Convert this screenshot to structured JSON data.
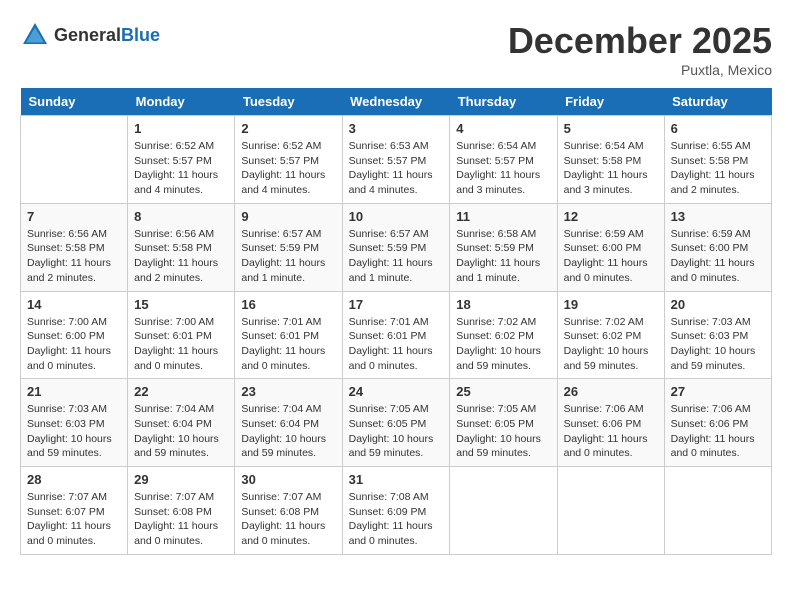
{
  "header": {
    "logo": {
      "general": "General",
      "blue": "Blue"
    },
    "title": "December 2025",
    "location": "Puxtla, Mexico"
  },
  "days_of_week": [
    "Sunday",
    "Monday",
    "Tuesday",
    "Wednesday",
    "Thursday",
    "Friday",
    "Saturday"
  ],
  "weeks": [
    [
      {
        "day": "",
        "info": ""
      },
      {
        "day": "1",
        "info": "Sunrise: 6:52 AM\nSunset: 5:57 PM\nDaylight: 11 hours and 4 minutes."
      },
      {
        "day": "2",
        "info": "Sunrise: 6:52 AM\nSunset: 5:57 PM\nDaylight: 11 hours and 4 minutes."
      },
      {
        "day": "3",
        "info": "Sunrise: 6:53 AM\nSunset: 5:57 PM\nDaylight: 11 hours and 4 minutes."
      },
      {
        "day": "4",
        "info": "Sunrise: 6:54 AM\nSunset: 5:57 PM\nDaylight: 11 hours and 3 minutes."
      },
      {
        "day": "5",
        "info": "Sunrise: 6:54 AM\nSunset: 5:58 PM\nDaylight: 11 hours and 3 minutes."
      },
      {
        "day": "6",
        "info": "Sunrise: 6:55 AM\nSunset: 5:58 PM\nDaylight: 11 hours and 2 minutes."
      }
    ],
    [
      {
        "day": "7",
        "info": "Sunrise: 6:56 AM\nSunset: 5:58 PM\nDaylight: 11 hours and 2 minutes."
      },
      {
        "day": "8",
        "info": "Sunrise: 6:56 AM\nSunset: 5:58 PM\nDaylight: 11 hours and 2 minutes."
      },
      {
        "day": "9",
        "info": "Sunrise: 6:57 AM\nSunset: 5:59 PM\nDaylight: 11 hours and 1 minute."
      },
      {
        "day": "10",
        "info": "Sunrise: 6:57 AM\nSunset: 5:59 PM\nDaylight: 11 hours and 1 minute."
      },
      {
        "day": "11",
        "info": "Sunrise: 6:58 AM\nSunset: 5:59 PM\nDaylight: 11 hours and 1 minute."
      },
      {
        "day": "12",
        "info": "Sunrise: 6:59 AM\nSunset: 6:00 PM\nDaylight: 11 hours and 0 minutes."
      },
      {
        "day": "13",
        "info": "Sunrise: 6:59 AM\nSunset: 6:00 PM\nDaylight: 11 hours and 0 minutes."
      }
    ],
    [
      {
        "day": "14",
        "info": "Sunrise: 7:00 AM\nSunset: 6:00 PM\nDaylight: 11 hours and 0 minutes."
      },
      {
        "day": "15",
        "info": "Sunrise: 7:00 AM\nSunset: 6:01 PM\nDaylight: 11 hours and 0 minutes."
      },
      {
        "day": "16",
        "info": "Sunrise: 7:01 AM\nSunset: 6:01 PM\nDaylight: 11 hours and 0 minutes."
      },
      {
        "day": "17",
        "info": "Sunrise: 7:01 AM\nSunset: 6:01 PM\nDaylight: 11 hours and 0 minutes."
      },
      {
        "day": "18",
        "info": "Sunrise: 7:02 AM\nSunset: 6:02 PM\nDaylight: 10 hours and 59 minutes."
      },
      {
        "day": "19",
        "info": "Sunrise: 7:02 AM\nSunset: 6:02 PM\nDaylight: 10 hours and 59 minutes."
      },
      {
        "day": "20",
        "info": "Sunrise: 7:03 AM\nSunset: 6:03 PM\nDaylight: 10 hours and 59 minutes."
      }
    ],
    [
      {
        "day": "21",
        "info": "Sunrise: 7:03 AM\nSunset: 6:03 PM\nDaylight: 10 hours and 59 minutes."
      },
      {
        "day": "22",
        "info": "Sunrise: 7:04 AM\nSunset: 6:04 PM\nDaylight: 10 hours and 59 minutes."
      },
      {
        "day": "23",
        "info": "Sunrise: 7:04 AM\nSunset: 6:04 PM\nDaylight: 10 hours and 59 minutes."
      },
      {
        "day": "24",
        "info": "Sunrise: 7:05 AM\nSunset: 6:05 PM\nDaylight: 10 hours and 59 minutes."
      },
      {
        "day": "25",
        "info": "Sunrise: 7:05 AM\nSunset: 6:05 PM\nDaylight: 10 hours and 59 minutes."
      },
      {
        "day": "26",
        "info": "Sunrise: 7:06 AM\nSunset: 6:06 PM\nDaylight: 11 hours and 0 minutes."
      },
      {
        "day": "27",
        "info": "Sunrise: 7:06 AM\nSunset: 6:06 PM\nDaylight: 11 hours and 0 minutes."
      }
    ],
    [
      {
        "day": "28",
        "info": "Sunrise: 7:07 AM\nSunset: 6:07 PM\nDaylight: 11 hours and 0 minutes."
      },
      {
        "day": "29",
        "info": "Sunrise: 7:07 AM\nSunset: 6:08 PM\nDaylight: 11 hours and 0 minutes."
      },
      {
        "day": "30",
        "info": "Sunrise: 7:07 AM\nSunset: 6:08 PM\nDaylight: 11 hours and 0 minutes."
      },
      {
        "day": "31",
        "info": "Sunrise: 7:08 AM\nSunset: 6:09 PM\nDaylight: 11 hours and 0 minutes."
      },
      {
        "day": "",
        "info": ""
      },
      {
        "day": "",
        "info": ""
      },
      {
        "day": "",
        "info": ""
      }
    ]
  ]
}
